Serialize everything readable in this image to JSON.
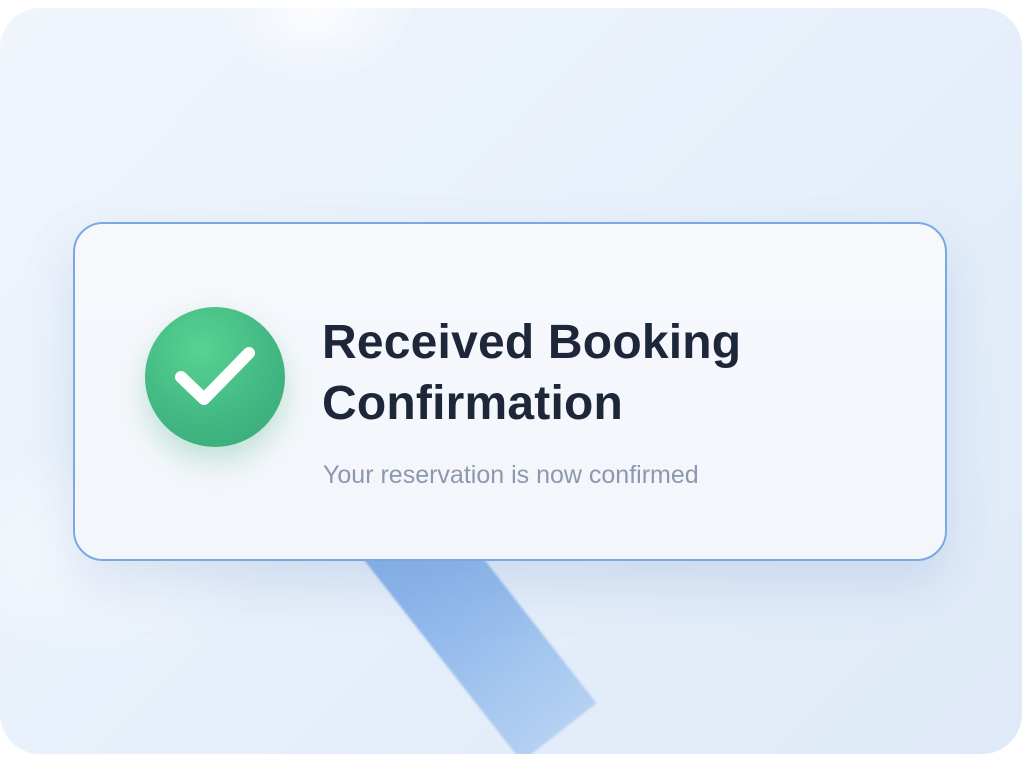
{
  "notification": {
    "icon": "checkmark-icon",
    "title": "Received Booking Confirmation",
    "message": "Your reservation is now confirmed"
  },
  "colors": {
    "success": "#42b883",
    "card_border": "#7aa9e2",
    "title_text": "#1d2739",
    "message_text": "#8c98ad"
  }
}
